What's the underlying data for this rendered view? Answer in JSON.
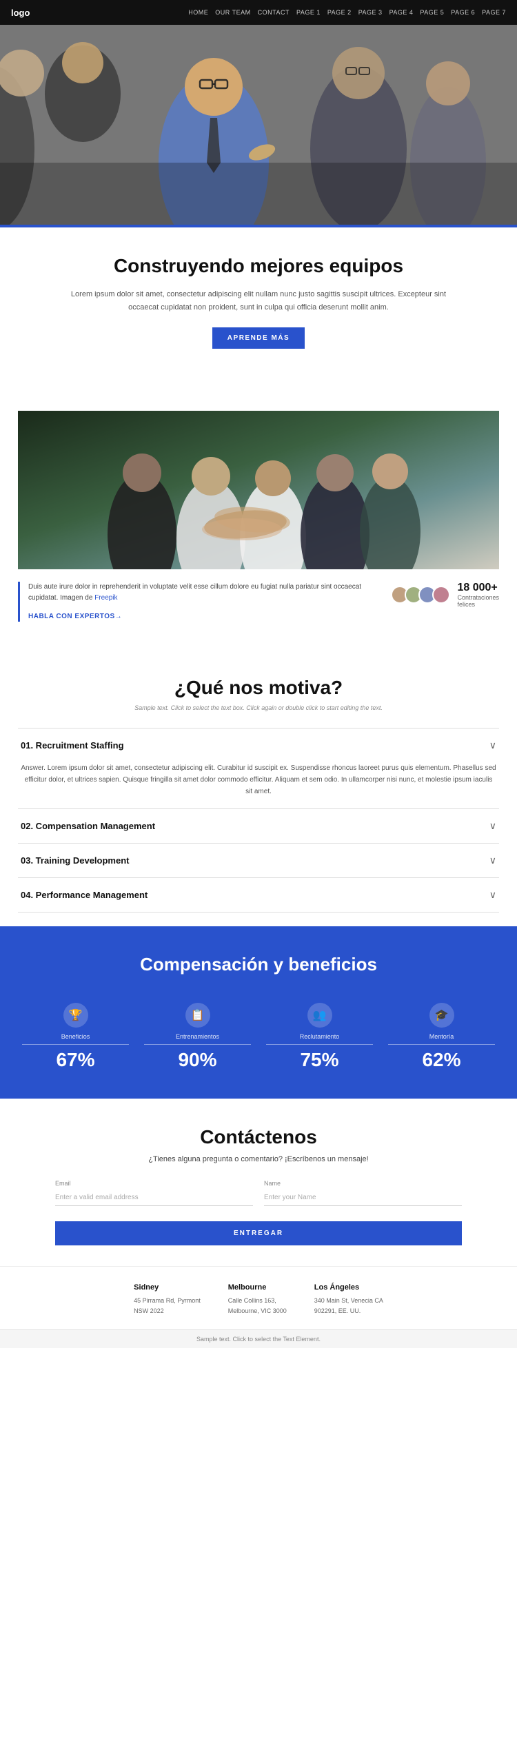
{
  "nav": {
    "logo": "logo",
    "links": [
      "HOME",
      "OUR TEAM",
      "CONTACT",
      "PAGE 1",
      "PAGE 2",
      "PAGE 3",
      "PAGE 4",
      "PAGE 5",
      "PAGE 6",
      "PAGE 7"
    ]
  },
  "hero": {
    "alt": "Business team meeting"
  },
  "section1": {
    "title": "Construyendo mejores equipos",
    "body": "Lorem ipsum dolor sit amet, consectetur adipiscing elit nullam nunc justo sagittis suscipit ultrices. Excepteur sint occaecat cupidatat non proident, sunt in culpa qui officia deserunt mollit anim.",
    "button_label": "APRENDE MÁS"
  },
  "section2": {
    "alt": "Team hands together"
  },
  "stats": {
    "body": "Duis aute irure dolor in reprehenderit in voluptate velit esse cillum dolore eu fugiat nulla pariatur sint occaecat cupidatat. Imagen de Freepik",
    "link": "HABLA CON EXPERTOS→",
    "count": "18 000+",
    "count_label": "Contrataciones\nfelices"
  },
  "motiva": {
    "title": "¿Qué nos motiva?",
    "subtitle": "Sample text. Click to select the text box. Click again or double click to start editing the text.",
    "accordion": [
      {
        "id": "01",
        "title": "01. Recruitment Staffing",
        "open": true,
        "answer": "Answer. Lorem ipsum dolor sit amet, consectetur adipiscing elit. Curabitur id suscipit ex. Suspendisse rhoncus laoreet purus quis elementum. Phasellus sed efficitur dolor, et ultrices sapien. Quisque fringilla sit amet dolor commodo efficitur. Aliquam et sem odio. In ullamcorper nisi nunc, et molestie ipsum iaculis sit amet."
      },
      {
        "id": "02",
        "title": "02. Compensation Management",
        "open": false,
        "answer": ""
      },
      {
        "id": "03",
        "title": "03. Training Development",
        "open": false,
        "answer": ""
      },
      {
        "id": "04",
        "title": "04. Performance Management",
        "open": false,
        "answer": ""
      }
    ]
  },
  "compensation": {
    "title": "Compensación y beneficios",
    "cards": [
      {
        "icon": "🏆",
        "label": "Beneficios",
        "percent": "67%"
      },
      {
        "icon": "📋",
        "label": "Entrenamientos",
        "percent": "90%"
      },
      {
        "icon": "👥",
        "label": "Reclutamiento",
        "percent": "75%"
      },
      {
        "icon": "🎓",
        "label": "Mentoría",
        "percent": "62%"
      }
    ]
  },
  "contact": {
    "title": "Contáctenos",
    "subtitle": "¿Tienes alguna pregunta o comentario? ¡Escríbenos un mensaje!",
    "email_label": "Email",
    "email_placeholder": "Enter a valid email address",
    "name_label": "Name",
    "name_placeholder": "Enter your Name",
    "button_label": "ENTREGAR"
  },
  "locations": [
    {
      "city": "Sidney",
      "address": "45 Pirrama Rd, Pyrmont NSW 2022"
    },
    {
      "city": "Melbourne",
      "address": "Calle Collins 163, Melbourne, VIC 3000"
    },
    {
      "city": "Los Ángeles",
      "address": "340 Main St, Venecia CA 902291, EE. UU."
    }
  ],
  "bottom_bar": "Sample text. Click to select the Text Element."
}
